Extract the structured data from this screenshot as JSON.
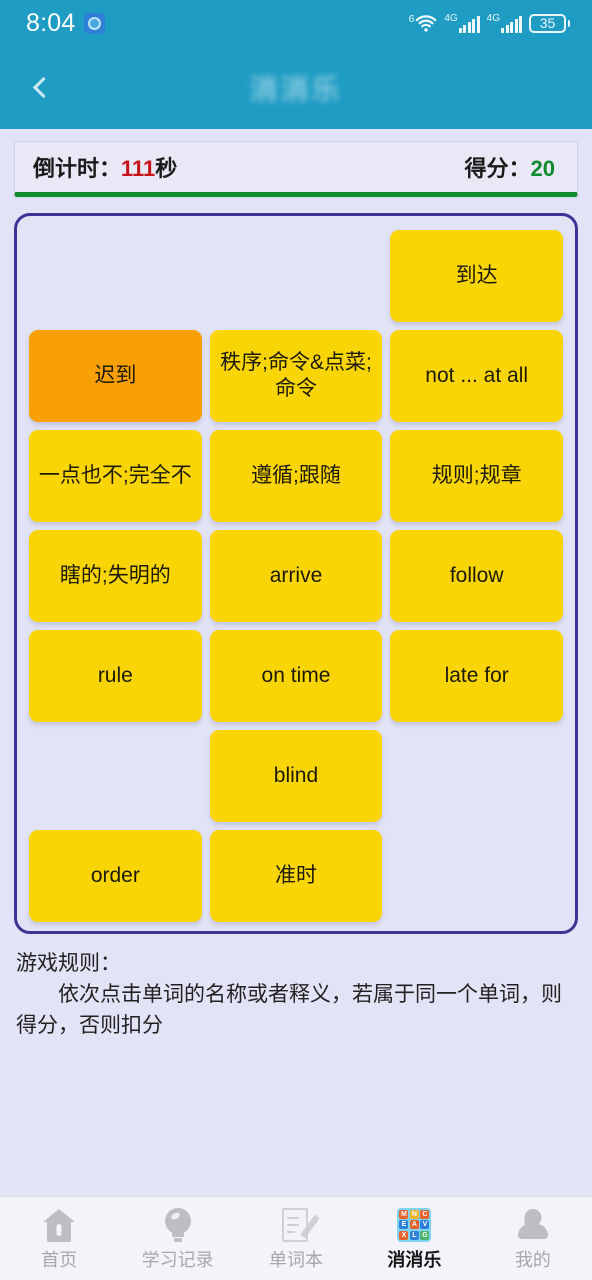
{
  "status_bar": {
    "time": "8:04",
    "app_badge_icon": "app-badge-icon",
    "wifi_label": "6",
    "wifi_icon": "wifi-icon",
    "sim1_label": "4G",
    "sim2_label": "4G",
    "signal_icon": "signal-bars-icon",
    "battery_level": "35"
  },
  "header": {
    "back_icon": "back-chevron-icon",
    "title": "消消乐"
  },
  "panel": {
    "countdown_label": "倒计时：",
    "countdown_value": "111",
    "countdown_unit": "秒",
    "score_label": "得分：",
    "score_value": "20",
    "accent_red": "#c7141b",
    "accent_green": "#0f8a2c"
  },
  "board": {
    "border_color": "#3b3494",
    "tile_color": "#fad505",
    "tile_selected_color": "#f9a006",
    "columns": 3,
    "cells": [
      {
        "text": "",
        "empty": true,
        "selected": false
      },
      {
        "text": "",
        "empty": true,
        "selected": false
      },
      {
        "text": "到达",
        "empty": false,
        "selected": false
      },
      {
        "text": "迟到",
        "empty": false,
        "selected": true
      },
      {
        "text": "秩序;命令&点菜;命令",
        "empty": false,
        "selected": false
      },
      {
        "text": "not ... at all",
        "empty": false,
        "selected": false
      },
      {
        "text": "一点也不;完全不",
        "empty": false,
        "selected": false
      },
      {
        "text": "遵循;跟随",
        "empty": false,
        "selected": false
      },
      {
        "text": "规则;规章",
        "empty": false,
        "selected": false
      },
      {
        "text": "瞎的;失明的",
        "empty": false,
        "selected": false
      },
      {
        "text": "arrive",
        "empty": false,
        "selected": false
      },
      {
        "text": "follow",
        "empty": false,
        "selected": false
      },
      {
        "text": "rule",
        "empty": false,
        "selected": false
      },
      {
        "text": "on time",
        "empty": false,
        "selected": false
      },
      {
        "text": "late for",
        "empty": false,
        "selected": false
      },
      {
        "text": "",
        "empty": true,
        "selected": false
      },
      {
        "text": "blind",
        "empty": false,
        "selected": false
      },
      {
        "text": "",
        "empty": true,
        "selected": false
      },
      {
        "text": "order",
        "empty": false,
        "selected": false
      },
      {
        "text": "准时",
        "empty": false,
        "selected": false
      },
      {
        "text": "",
        "empty": true,
        "selected": false
      }
    ]
  },
  "rules": {
    "title": "游戏规则：",
    "body": "依次点击单词的名称或者释义，若属于同一个单词，则得分，否则扣分"
  },
  "tabbar": {
    "items": [
      {
        "label": "首页",
        "icon": "home-icon",
        "active": false
      },
      {
        "label": "学习记录",
        "icon": "lightbulb-icon",
        "active": false
      },
      {
        "label": "单词本",
        "icon": "notebook-icon",
        "active": false
      },
      {
        "label": "消消乐",
        "icon": "game-grid-icon",
        "active": true
      },
      {
        "label": "我的",
        "icon": "user-icon",
        "active": false
      }
    ]
  }
}
